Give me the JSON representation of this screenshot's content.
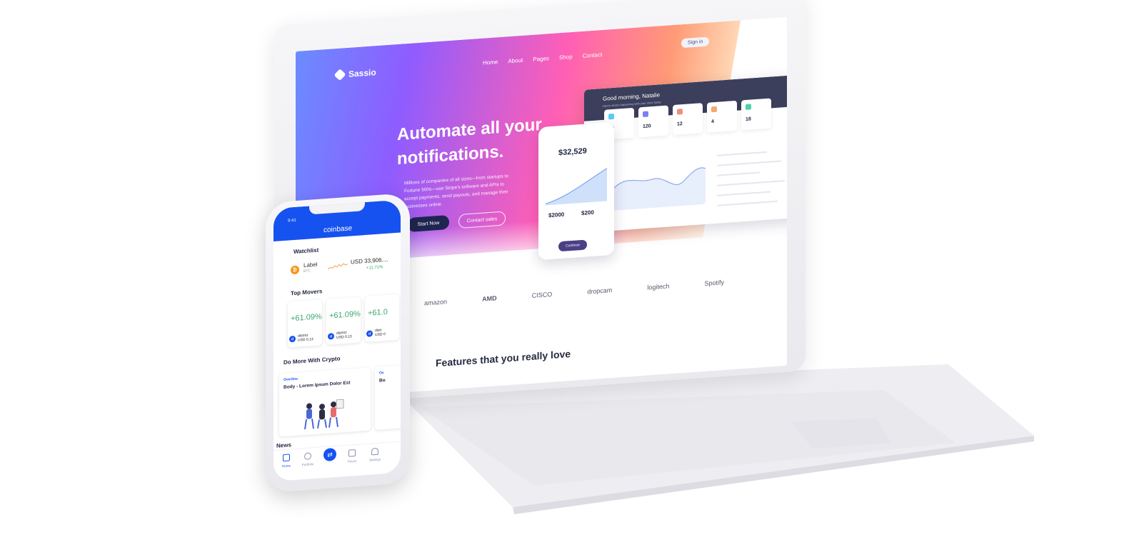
{
  "laptop": {
    "site": {
      "logo": "Sassio",
      "nav": [
        "Home",
        "About",
        "Pages",
        "Shop",
        "Contact"
      ],
      "signin": "Sign in",
      "headline_line1": "Automate all your",
      "headline_line2": "notifications.",
      "subtext": "Millions of companies of all sizes—from startups to Fortune 500s—use Stripe's software and APIs to accept payments, send payouts, and manage their businesses online.",
      "cta_primary": "Start Now",
      "cta_secondary": "Contact sales",
      "brands": [
        "amazon",
        "AMD",
        "CISCO",
        "dropcam",
        "logitech",
        "Spotify"
      ],
      "features_heading": "Features that you really love"
    },
    "dashboard": {
      "greeting": "Good morning, Natalie",
      "greeting_sub": "Here's what's happening with your store today",
      "card_values": [
        "12",
        "120",
        "12",
        "4",
        "18"
      ],
      "mini_amount": "$32,529",
      "mini_left": "$2000",
      "mini_right": "$200",
      "mini_button": "Continue"
    }
  },
  "phone": {
    "time": "9:41",
    "app_title": "coinbase",
    "watchlist_title": "Watchlist",
    "watch_item": {
      "label": "Label",
      "ticker": "BTC",
      "price": "USD 33,906....",
      "change": "+11.71%"
    },
    "top_movers_title": "Top Movers",
    "movers": [
      {
        "pct": "+61.09%",
        "name": "district",
        "price": "USD 0.13"
      },
      {
        "pct": "+61.09%",
        "name": "district",
        "price": "USD 0.13"
      },
      {
        "pct": "+61.0",
        "name": "distr",
        "price": "USD 0"
      }
    ],
    "do_more_title": "Do More With Crypto",
    "card": {
      "tag": "Overline",
      "body": "Body - Lorem Ipsum Dolor Est",
      "tag2": "Ov",
      "body2": "Bo"
    },
    "news_title": "News",
    "tabs": [
      "Home",
      "Portfolio",
      "Prices",
      "Settings"
    ]
  }
}
